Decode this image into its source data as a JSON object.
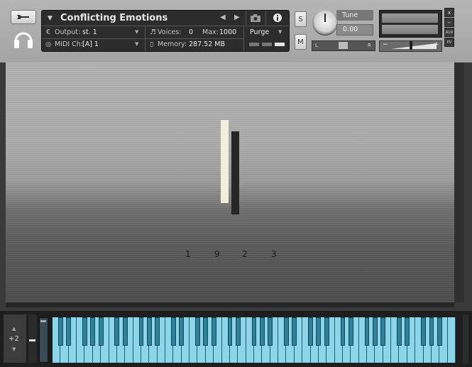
{
  "header": {
    "instrument_name": "Conflicting Emotions",
    "output_label": "Output:",
    "output_value": "st. 1",
    "voices_label": "Voices:",
    "voices_value": "0",
    "max_label": "Max:",
    "max_value": "1000",
    "purge_label": "Purge",
    "midi_label": "MIDI Ch:",
    "midi_value": "[A]  1",
    "memory_label": "Memory:",
    "memory_value": "287.52 MB",
    "solo_label": "S",
    "mute_label": "M",
    "tune_label": "Tune",
    "tune_value": "0.00",
    "pan_left": "L",
    "pan_right": "R",
    "vol_minus": "−",
    "vol_plus": "+",
    "side_close": "x",
    "side_minimize": "−",
    "side_aux": "AUX",
    "side_pv": "PV"
  },
  "gui": {
    "numbers": [
      "1",
      "9",
      "2",
      "3"
    ]
  },
  "keyboard": {
    "octave_value": "+2"
  },
  "colors": {
    "light_bar": "#f3eedb",
    "dark_bar": "#262626",
    "white_key": "#8dd6ea",
    "black_key": "#2f8199"
  }
}
